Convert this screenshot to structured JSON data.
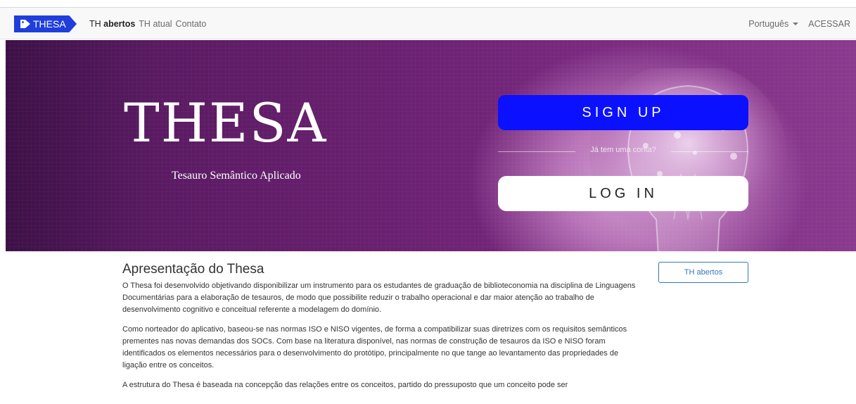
{
  "navbar": {
    "brand": "THESA",
    "links": [
      {
        "prefix": "TH ",
        "label": "abertos",
        "active": true
      },
      {
        "prefix": "TH ",
        "label": "atual",
        "active": false
      },
      {
        "prefix": "",
        "label": "Contato",
        "active": false
      }
    ],
    "language": "Português",
    "login": "ACESSAR"
  },
  "hero": {
    "logo": "THESA",
    "subtitle": "Tesauro Semântico Aplicado",
    "signup": "SIGN UP",
    "divider_text": "Já tem uma conta?",
    "login": "LOG IN"
  },
  "content": {
    "title": "Apresentação do Thesa",
    "paragraphs": [
      "O Thesa foi desenvolvido objetivando disponibilizar um instrumento para os estudantes de graduação de biblioteconomia na disciplina de Linguagens Documentárias para a elaboração de tesauros, de modo que possibilite reduzir o trabalho operacional e dar maior atenção ao trabalho de desenvolvimento cognitivo e conceitual referente a modelagem do domínio.",
      "Como norteador do aplicativo, baseou-se nas normas ISO e NISO vigentes, de forma a compatibilizar suas diretrizes com os requisitos semânticos prementes nas novas demandas dos SOCs. Com base na literatura disponível, nas normas de construção de tesauros da ISO e NISO foram identificados os elementos necessários para o desenvolvimento do protótipo, principalmente no que tange ao levantamento das propriedades de ligação entre os conceitos.",
      "A estrutura do Thesa é baseada na concepção das relações entre os conceitos, partido do pressuposto que um conceito pode ser"
    ],
    "side_button": "TH abertos"
  },
  "colors": {
    "brand_blue": "#1f3edb",
    "signup_blue": "#0b10ff",
    "hero_purple": "#6a2070",
    "link_blue": "#337ab7"
  }
}
